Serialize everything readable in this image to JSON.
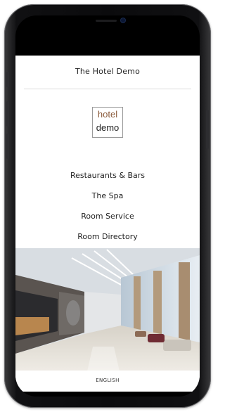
{
  "app": {
    "title": "The Hotel Demo",
    "logo_line1": "hotel",
    "logo_line2": "demo"
  },
  "menu": {
    "items": [
      {
        "label": "Restaurants & Bars"
      },
      {
        "label": "The Spa"
      },
      {
        "label": "Room Service"
      },
      {
        "label": "Room Directory"
      }
    ]
  },
  "hero": {
    "icon": "hotel-lobby-photo"
  },
  "footer": {
    "language": "ENGLISH"
  },
  "colors": {
    "background": "#ffffff",
    "text": "#222222",
    "divider": "#dcdcdc",
    "logo_accent": "#8a5a3a",
    "phone_frame": "#0b0b0d"
  }
}
